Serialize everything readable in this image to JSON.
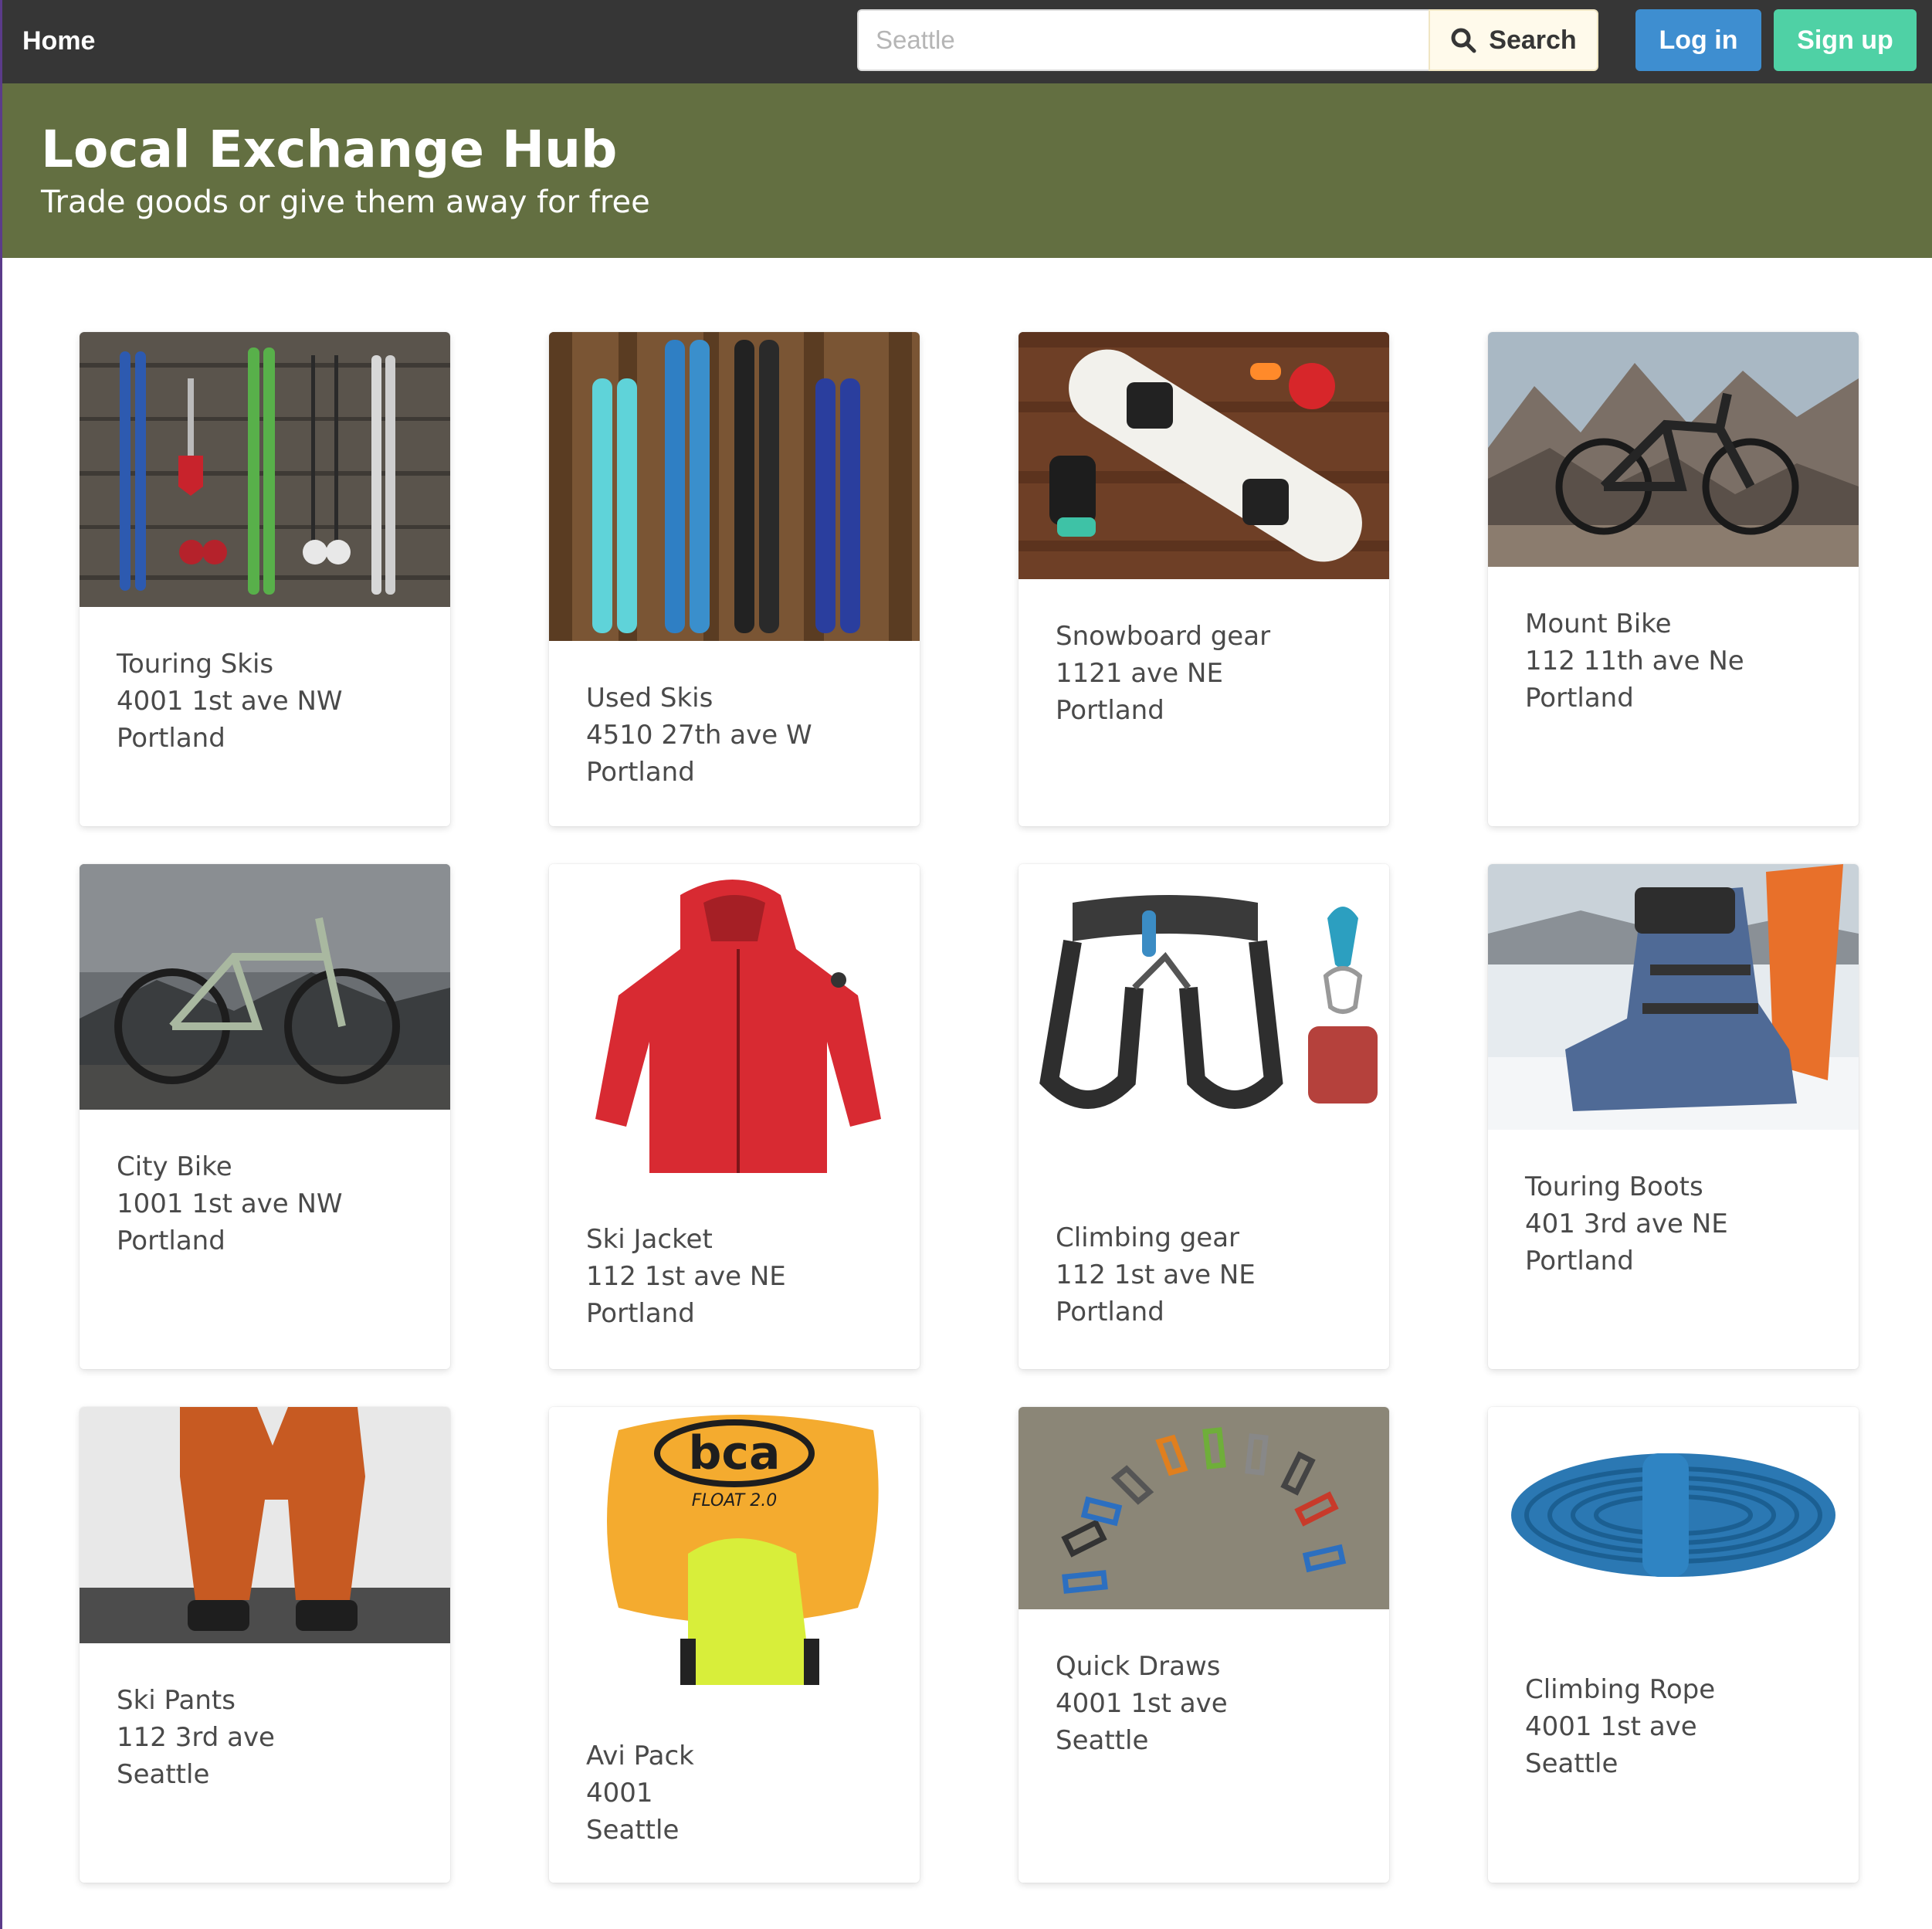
{
  "nav": {
    "home_label": "Home",
    "search_placeholder": "Seattle",
    "search_label": "Search",
    "login_label": "Log in",
    "signup_label": "Sign up"
  },
  "hero": {
    "title": "Local Exchange Hub",
    "subtitle": "Trade goods or give them away for free"
  },
  "colors": {
    "navbar": "#363636",
    "hero": "#636f41",
    "login": "#3e8ed0",
    "signup": "#4fd1a5",
    "search_button": "#fffaeb"
  },
  "listings": [
    {
      "title": "Touring Skis",
      "address": "4001 1st ave NW",
      "city": "Portland",
      "image_icon": "skis-on-wood-wall-photo"
    },
    {
      "title": "Used Skis",
      "address": "4510 27th ave W",
      "city": "Portland",
      "image_icon": "skis-rack-photo"
    },
    {
      "title": "Snowboard gear",
      "address": "1121 ave NE",
      "city": "Portland",
      "image_icon": "snowboard-photo"
    },
    {
      "title": "Mount Bike",
      "address": "112 11th ave Ne",
      "city": "Portland",
      "image_icon": "mountain-bike-photo"
    },
    {
      "title": "City Bike",
      "address": "1001 1st ave NW",
      "city": "Portland",
      "image_icon": "city-bike-photo"
    },
    {
      "title": "Ski Jacket",
      "address": "112 1st ave NE",
      "city": "Portland",
      "image_icon": "red-jacket-photo"
    },
    {
      "title": "Climbing gear",
      "address": "112 1st ave NE",
      "city": "Portland",
      "image_icon": "climbing-harness-photo"
    },
    {
      "title": "Touring Boots",
      "address": "401 3rd ave NE",
      "city": "Portland",
      "image_icon": "ski-boot-photo"
    },
    {
      "title": "Ski Pants",
      "address": "112 3rd ave",
      "city": "Seattle",
      "image_icon": "orange-pants-photo"
    },
    {
      "title": "Avi Pack",
      "address": "4001",
      "city": "Seattle",
      "image_icon": "avalanche-pack-photo",
      "logo_text": "bca",
      "logo_sub": "FLOAT 2.0"
    },
    {
      "title": "Quick Draws",
      "address": "4001 1st ave",
      "city": "Seattle",
      "image_icon": "quickdraws-photo"
    },
    {
      "title": "Climbing Rope",
      "address": "4001 1st ave",
      "city": "Seattle",
      "image_icon": "blue-rope-photo"
    }
  ]
}
